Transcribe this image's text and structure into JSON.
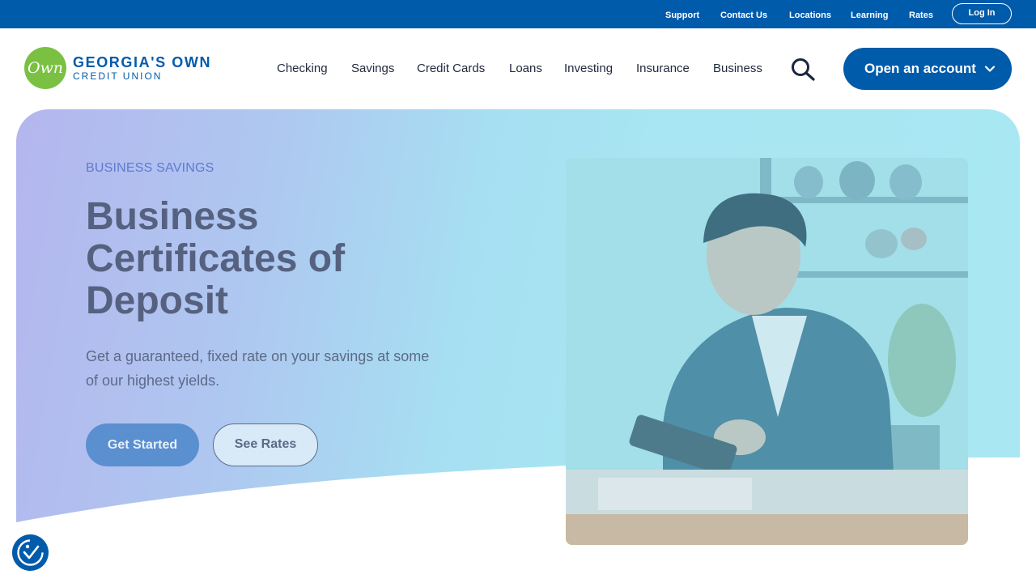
{
  "utility_bar": {
    "links": [
      "Support",
      "Contact Us",
      "Locations",
      "Learning",
      "Rates"
    ],
    "login_label": "Log In"
  },
  "brand": {
    "logo_mark": "Own",
    "name": "GEORGIA'S OWN",
    "subtitle": "CREDIT UNION"
  },
  "nav": {
    "items": [
      "Checking",
      "Savings",
      "Credit Cards",
      "Loans",
      "Investing",
      "Insurance",
      "Business"
    ],
    "search_icon": "search-icon",
    "cta_label": "Open an account"
  },
  "hero": {
    "eyebrow": "BUSINESS SAVINGS",
    "title": "Business Certificates of Deposit",
    "description": "Get a guaranteed, fixed rate on your savings at some of our highest yields.",
    "primary_button": "Get Started",
    "secondary_button": "See Rates"
  },
  "colors": {
    "brand_blue": "#005bab",
    "logo_green": "#7ac143",
    "hero_gradient_start": "#b4b6ee",
    "hero_gradient_end": "#a9e8f3"
  },
  "accessibility_icon": "accessibility-icon"
}
